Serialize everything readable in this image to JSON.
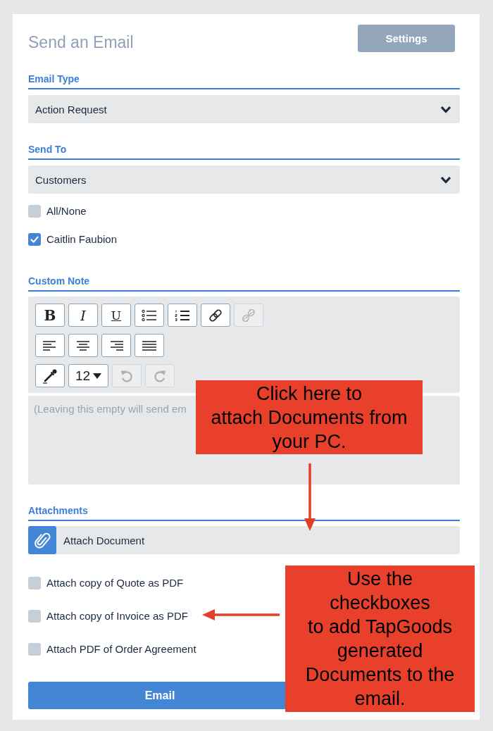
{
  "header": {
    "title": "Send an Email",
    "settings_button": "Settings"
  },
  "email_type": {
    "label": "Email Type",
    "value": "Action Request"
  },
  "send_to": {
    "label": "Send To",
    "value": "Customers",
    "recipients": [
      {
        "label": "All/None",
        "checked": false
      },
      {
        "label": "Caitlin Faubion",
        "checked": true
      }
    ]
  },
  "custom_note": {
    "label": "Custom Note",
    "toolbar": [
      [
        {
          "kind": "bold",
          "text": "B",
          "disabled": false
        },
        {
          "kind": "italic",
          "text": "I",
          "disabled": false
        },
        {
          "kind": "underline",
          "text": "U",
          "disabled": false
        },
        {
          "kind": "bullet-list",
          "disabled": false
        },
        {
          "kind": "numbered-list",
          "disabled": false
        },
        {
          "kind": "link",
          "disabled": false
        },
        {
          "kind": "unlink",
          "disabled": true
        }
      ],
      [
        {
          "kind": "align-left",
          "disabled": false
        },
        {
          "kind": "align-center",
          "disabled": false
        },
        {
          "kind": "align-right",
          "disabled": false
        },
        {
          "kind": "justify",
          "disabled": false
        }
      ],
      [
        {
          "kind": "text-color",
          "disabled": false
        },
        {
          "kind": "font-size",
          "text": "12",
          "disabled": false
        },
        {
          "kind": "undo",
          "disabled": true
        },
        {
          "kind": "redo",
          "disabled": true
        }
      ]
    ],
    "placeholder": "(Leaving this empty will send em"
  },
  "attachments": {
    "label": "Attachments",
    "attach_button": "Attach Document",
    "options": [
      {
        "label": "Attach copy of Quote as PDF",
        "checked": false
      },
      {
        "label": "Attach copy of Invoice as PDF",
        "checked": false
      },
      {
        "label": "Attach PDF of Order Agreement",
        "checked": false
      }
    ]
  },
  "email_button": "Email",
  "annotations": [
    {
      "kind": "down",
      "text": "Click here to\nattach Documents from\nyour PC."
    },
    {
      "kind": "left",
      "text": "Use the\ncheckboxes\nto add TapGoods\ngenerated\nDocuments to the\nemail."
    }
  ]
}
